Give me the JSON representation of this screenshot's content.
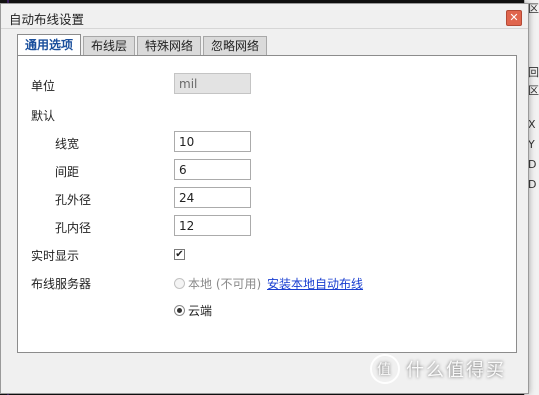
{
  "dialog": {
    "title": "自动布线设置",
    "close_glyph": "✕"
  },
  "tabs": [
    {
      "label": "通用选项",
      "active": true
    },
    {
      "label": "布线层",
      "active": false
    },
    {
      "label": "特殊网络",
      "active": false
    },
    {
      "label": "忽略网络",
      "active": false
    }
  ],
  "general": {
    "unit_label": "单位",
    "unit_value": "mil",
    "defaults_label": "默认",
    "line_width_label": "线宽",
    "line_width_value": "10",
    "clearance_label": "间距",
    "clearance_value": "6",
    "via_outer_label": "孔外径",
    "via_outer_value": "24",
    "via_inner_label": "孔内径",
    "via_inner_value": "12",
    "realtime_label": "实时显示",
    "realtime_checked": true,
    "realtime_glyph": "✔",
    "server_label": "布线服务器",
    "local_option": "本地 (不可用)",
    "install_link": "安装本地自动布线",
    "cloud_option": "云端"
  },
  "watermark": {
    "logo": "值",
    "text": "什么值得买"
  },
  "side_panel_glyphs": [
    "区",
    "回",
    "区",
    "X",
    "Y",
    "D",
    "D"
  ],
  "colors": {
    "accent_tab": "#1a4f9c",
    "close_button": "#e0654d",
    "link": "#1a3fd1"
  }
}
